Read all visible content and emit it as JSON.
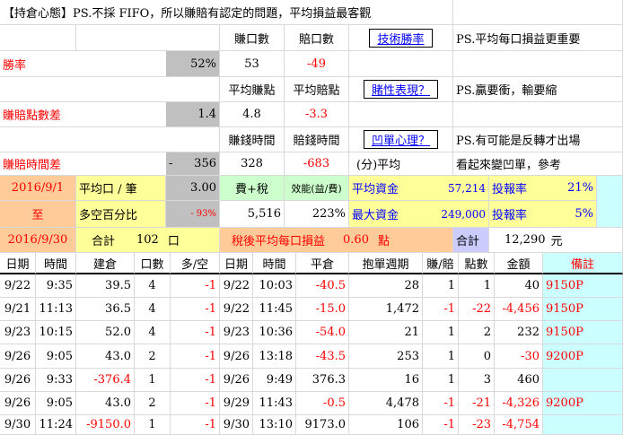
{
  "title_note": "【持倉心態】PS.不採 FIFO，所以賺賠有認定的問題，平均損益最客觀",
  "stats": {
    "win_rate_label": "勝率",
    "win_rate_value": "52%",
    "diff_points_label": "賺賠點數差",
    "diff_points_value": "1.4",
    "diff_time_label": "賺賠時間差",
    "diff_time_sign": "-",
    "diff_time_value": "356",
    "win_count_label": "賺口數",
    "loss_count_label": "賠口數",
    "win_count": "53",
    "loss_count": "-49",
    "avg_win_label": "平均賺點",
    "avg_loss_label": "平均賠點",
    "avg_win": "4.8",
    "avg_loss": "-3.3",
    "win_time_label": "賺錢時間",
    "loss_time_label": "賠錢時間",
    "win_time": "328",
    "loss_time": "-683",
    "time_unit": "(分)平均",
    "link1": "技術勝率",
    "link2": "賭性表現？",
    "link3": "凹單心理？",
    "note1": "PS.平均每口損益更重要",
    "note2": "PS.贏要衝，輸要縮",
    "note3": "PS.有可能是反轉才出場",
    "note4": "看起來變凹單，參考"
  },
  "summary": {
    "start_date": "2016/9/1",
    "to": "至",
    "end_date": "2016/9/30",
    "avg_per_lot_label": "平均口 / 筆",
    "avg_per_lot": "3.00",
    "long_short_label": "多空百分比",
    "long_short": "- 93%",
    "fee_tax_label": "費+稅",
    "fee_tax": "5,516",
    "efficiency_label": "效能(益/費)",
    "efficiency": "223%",
    "avg_capital_label": "平均資金",
    "avg_capital": "57,214",
    "max_capital_label": "最大資金",
    "max_capital": "249,000",
    "roi_label": "投報率",
    "roi1": "21%",
    "roi2": "5%",
    "total_label": "合計",
    "total_lots": "102",
    "lot_unit": "口",
    "after_tax_label": "稅後平均每口損益",
    "after_tax_value": "0.60",
    "pt_unit": "點",
    "total2_label": "合計",
    "total_amount": "12,290",
    "currency": "元"
  },
  "table": {
    "headers": [
      "日期",
      "時間",
      "建倉",
      "口數",
      "多/空",
      "日期",
      "時間",
      "平倉",
      "抱單週期",
      "賺/賠",
      "點數",
      "金額",
      "備註"
    ],
    "rows": [
      [
        "9/22",
        "9:35",
        "39.5",
        "4",
        "-1",
        "9/22",
        "10:03",
        "-40.5",
        "28",
        "1",
        "1",
        "40",
        "9150P"
      ],
      [
        "9/21",
        "11:13",
        "36.5",
        "4",
        "-1",
        "9/22",
        "11:45",
        "-15.0",
        "1,472",
        "-1",
        "-22",
        "-4,456",
        "9150P"
      ],
      [
        "9/23",
        "10:15",
        "52.0",
        "4",
        "-1",
        "9/23",
        "10:36",
        "-54.0",
        "21",
        "1",
        "2",
        "232",
        "9150P"
      ],
      [
        "9/26",
        "9:05",
        "43.0",
        "2",
        "-1",
        "9/26",
        "13:18",
        "-43.5",
        "253",
        "1",
        "0",
        "-30",
        "9200P"
      ],
      [
        "9/26",
        "9:33",
        "-376.4",
        "1",
        "-1",
        "9/26",
        "9:49",
        "376.3",
        "16",
        "1",
        "3",
        "460",
        ""
      ],
      [
        "9/26",
        "9:05",
        "43.0",
        "2",
        "-1",
        "9/29",
        "11:43",
        "-0.5",
        "4,478",
        "-1",
        "-21",
        "-4,326",
        "9200P"
      ],
      [
        "9/30",
        "11:24",
        "-9150.0",
        "1",
        "-1",
        "9/30",
        "13:10",
        "9173.0",
        "106",
        "-1",
        "-23",
        "-4,754",
        ""
      ]
    ]
  }
}
